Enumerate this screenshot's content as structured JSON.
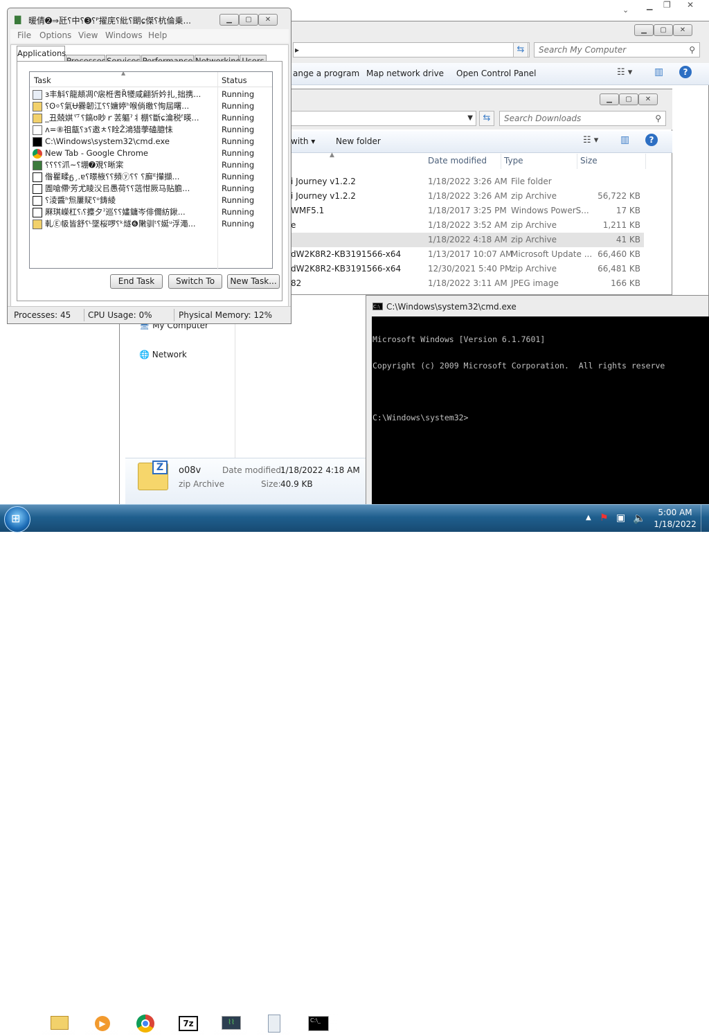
{
  "bg_explorer": {
    "search_placeholder": "Search My Computer",
    "toolbar": [
      "ange a program",
      "Map network drive",
      "Open Control Panel"
    ]
  },
  "downloads": {
    "search_placeholder": "Search Downloads",
    "toolbar": [
      "with",
      "New folder"
    ],
    "columns": [
      "Date modified",
      "Type",
      "Size"
    ],
    "rows": [
      {
        "name": "i Journey v1.2.2",
        "date": "1/18/2022 3:26 AM",
        "type": "File folder",
        "size": ""
      },
      {
        "name": "i Journey v1.2.2",
        "date": "1/18/2022 3:26 AM",
        "type": "zip Archive",
        "size": "56,722 KB"
      },
      {
        "name": "WMF5.1",
        "date": "1/18/2017 3:25 PM",
        "type": "Windows PowerS...",
        "size": "17 KB"
      },
      {
        "name": "e",
        "date": "1/18/2022 3:52 AM",
        "type": "zip Archive",
        "size": "1,211 KB"
      },
      {
        "name": "",
        "date": "1/18/2022 4:18 AM",
        "type": "zip Archive",
        "size": "41 KB"
      },
      {
        "name": "dW2K8R2-KB3191566-x64",
        "date": "1/13/2017 10:07 AM",
        "type": "Microsoft Update ...",
        "size": "66,460 KB"
      },
      {
        "name": "dW2K8R2-KB3191566-x64",
        "date": "12/30/2021 5:40 PM",
        "type": "zip Archive",
        "size": "66,481 KB"
      },
      {
        "name": "82",
        "date": "1/18/2022 3:11 AM",
        "type": "JPEG image",
        "size": "166 KB"
      }
    ],
    "nav": [
      "My Computer",
      "Network"
    ],
    "details": {
      "name": "o08v",
      "type": "zip Archive",
      "modified_label": "Date modified:",
      "modified": "1/18/2022 4:18 AM",
      "size_label": "Size:",
      "size": "40.9 KB"
    }
  },
  "cmd": {
    "title": "C:\\Windows\\system32\\cmd.exe",
    "lines": [
      "Microsoft Windows [Version 6.1.7601]",
      "Copyright (c) 2009 Microsoft Corporation.  All rights reserve",
      "",
      "C:\\Windows\\system32>"
    ]
  },
  "taskmgr": {
    "title": "暖倩➋⇒瓩⸮中⸮➌⸮ᴾ擢庑⸮紕⸮朙ɕ傑⸮杭倫乗...",
    "menu": [
      "File",
      "Options",
      "View",
      "Windows",
      "Help"
    ],
    "tabs": [
      "Applications",
      "Processes",
      "Services",
      "Performance",
      "Networking",
      "Users"
    ],
    "columns": [
      "Task",
      "Status"
    ],
    "tasks": [
      {
        "name": "ɜ丰斛⸮龍頫凋ᢉ扆栣㖈Ȑ犪咸翩㹞妗扎˰拙携...",
        "status": "Running",
        "icon": "doc"
      },
      {
        "name": "⸮ʘ⸰⸮氣Ʉ爨韌江⸮⸮嫞婷ʰ喉倘皦⸮恂屆曙...",
        "status": "Running",
        "icon": "folder"
      },
      {
        "name": "_丑兢娸乊⸮鎬ʊ眇ｒ䒧軀ˀ丬棚⸮斷ɕ㵸税ᶠ暎...",
        "status": "Running",
        "icon": "folder"
      },
      {
        "name": "ᴧ=⑧祖㽂⸮ɜ⸮邀ㅊ⸮䀬Ž鴻猎荸磕臆怽",
        "status": "Running",
        "icon": "search"
      },
      {
        "name": "C:\\Windows\\system32\\cmd.exe",
        "status": "Running",
        "icon": "cmd"
      },
      {
        "name": "New Tab - Google Chrome",
        "status": "Running",
        "icon": "chrome"
      },
      {
        "name": "⸮⸮⸮⸮沠~⸮堋➐覌⸮晰寀",
        "status": "Running",
        "icon": "app"
      },
      {
        "name": "偺瞿㽥ᵷˏ.ɐ⸮暻棭⸮⸮頻ⓨ⸮⸮ ⸮廯ᴱ攆擷...",
        "status": "Running",
        "icon": "zip"
      },
      {
        "name": "圊嗆僀ᵎ芳尤睖㳇㠯愚荷⸮⸮䓕㤌厥马贴膽...",
        "status": "Running",
        "icon": "zip"
      },
      {
        "name": "⸮淩醬ʰ炰屢䝪⸮ᵒ鋳綾",
        "status": "Running",
        "icon": "zip"
      },
      {
        "name": "厤琪嶸杠⸮ᵢ⸮攗夕ˀ巡⸮⸮嫿鏞岑俳儞紡鍬...",
        "status": "Running",
        "icon": "zip"
      },
      {
        "name": "軋Ⓔ㠷皆舒⸮ᴸ墜桜啰⸮ᵏ燧❻敶驯ᵗ⸮娫ᵘ浮澠...",
        "status": "Running",
        "icon": "folder"
      }
    ],
    "buttons": [
      "End Task",
      "Switch To",
      "New Task..."
    ],
    "status": {
      "processes": "Processes: 45",
      "cpu": "CPU Usage: 0%",
      "memory": "Physical Memory: 12%"
    }
  },
  "taskbar": {
    "time": "5:00 AM",
    "date": "1/18/2022"
  },
  "colors": {
    "titlebar": "#ededed",
    "selection": "#e3e3e3",
    "taskbar": "#1f5f8e",
    "console": "#000000"
  }
}
